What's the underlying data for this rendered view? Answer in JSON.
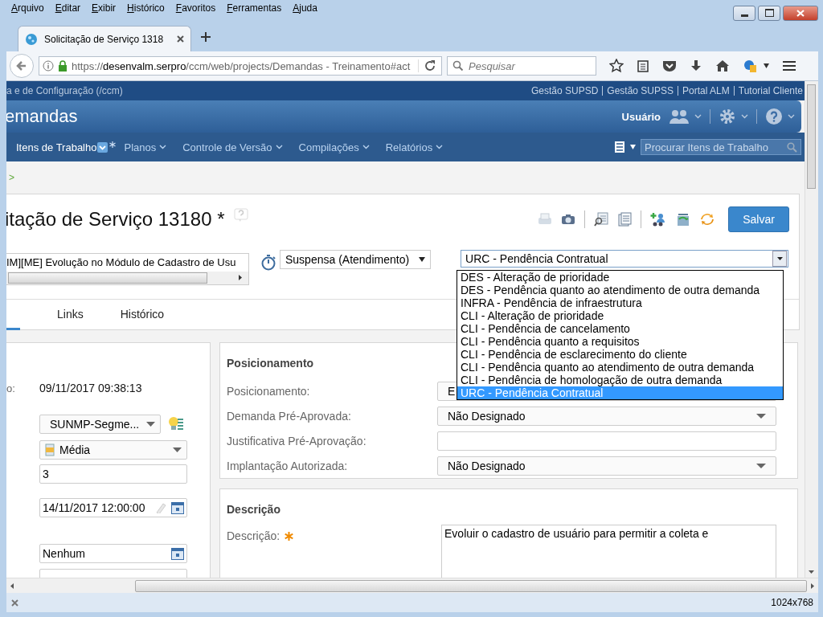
{
  "menu_bar": [
    "Arquivo",
    "Editar",
    "Exibir",
    "Histórico",
    "Favoritos",
    "Ferramentas",
    "Ajuda"
  ],
  "browser_tab": {
    "title": "Solicitação de Serviço 1318"
  },
  "address_bar": {
    "scheme": "https://",
    "host": "desenvalm.serpro",
    "path": "/ccm/web/projects/Demandas - Treinamento#act"
  },
  "search_field": {
    "placeholder": "Pesquisar"
  },
  "top_links": {
    "left": "a e de Configuração (/ccm)",
    "links": [
      "Gestão SUPSD",
      "Gestão SUPSS",
      "Portal ALM",
      "Tutorial Cliente"
    ]
  },
  "banner": {
    "title": "emandas",
    "user": "Usuário"
  },
  "nav": {
    "items": [
      {
        "label": "Itens de Trabalho",
        "selected": true,
        "modified": true
      },
      {
        "label": "Planos",
        "selected": false,
        "modified": false
      },
      {
        "label": "Controle de Versão",
        "selected": false,
        "modified": false
      },
      {
        "label": "Compilações",
        "selected": false,
        "modified": false
      },
      {
        "label": "Relatórios",
        "selected": false,
        "modified": false
      }
    ],
    "search_placeholder": "Procurar Itens de Trabalho"
  },
  "breadcrumb": ">",
  "work_item": {
    "title": "itação de Serviço 13180 *",
    "save": "Salvar",
    "summary": "IM][ME] Evolução no Módulo de Cadastro de Usu",
    "state": "Suspensa (Atendimento)",
    "resolution": {
      "value": "URC - Pendência Contratual",
      "expanded": true,
      "options": [
        {
          "label": "DES - Alteração de prioridade",
          "selected": false
        },
        {
          "label": "DES - Pendência quanto ao atendimento de outra demanda",
          "selected": false
        },
        {
          "label": "INFRA - Pendência de infraestrutura",
          "selected": false
        },
        {
          "label": "CLI - Alteração de prioridade",
          "selected": false
        },
        {
          "label": "CLI - Pendência de cancelamento",
          "selected": false
        },
        {
          "label": "CLI - Pendência quanto a requisitos",
          "selected": false
        },
        {
          "label": "CLI - Pendência de esclarecimento do cliente",
          "selected": false
        },
        {
          "label": "CLI - Pendência quanto ao atendimento de outra demanda",
          "selected": false
        },
        {
          "label": "CLI - Pendência de homologação de outra demanda",
          "selected": false
        },
        {
          "label": "URC - Pendência Contratual",
          "selected": true
        }
      ]
    }
  },
  "tabs": [
    {
      "selected": true
    },
    {
      "label": "Links",
      "selected": false
    },
    {
      "label": "Histórico",
      "selected": false
    }
  ],
  "left_fields": [
    {
      "kind": "text",
      "label": "o:",
      "value": "09/11/2017 09:38:13"
    },
    {
      "kind": "select",
      "value": "SUNMP-Segme..."
    },
    {
      "kind": "priority",
      "value": "Média"
    },
    {
      "kind": "input",
      "value": "3"
    },
    {
      "kind": "date",
      "value": "14/11/2017 12:00:00"
    },
    {
      "kind": "picker",
      "value": "Nenhum"
    },
    {
      "kind": "input"
    }
  ],
  "posicionamento": {
    "title": "Posicionamento",
    "fields": [
      {
        "kind": "select",
        "label": "Posicionamento:",
        "value": "E"
      },
      {
        "kind": "select",
        "label": "Demanda Pré-Aprovada:",
        "value": "Não Designado"
      },
      {
        "kind": "input",
        "label": "Justificativa Pré-Aprovação:"
      },
      {
        "kind": "select",
        "label": "Implantação Autorizada:",
        "value": "Não Designado"
      }
    ]
  },
  "descricao": {
    "title": "Descrição",
    "label": "Descrição:",
    "required": true,
    "value": "Evoluir o cadastro de usuário para permitir a coleta e"
  },
  "status_bar": {
    "size": "1024x768"
  }
}
